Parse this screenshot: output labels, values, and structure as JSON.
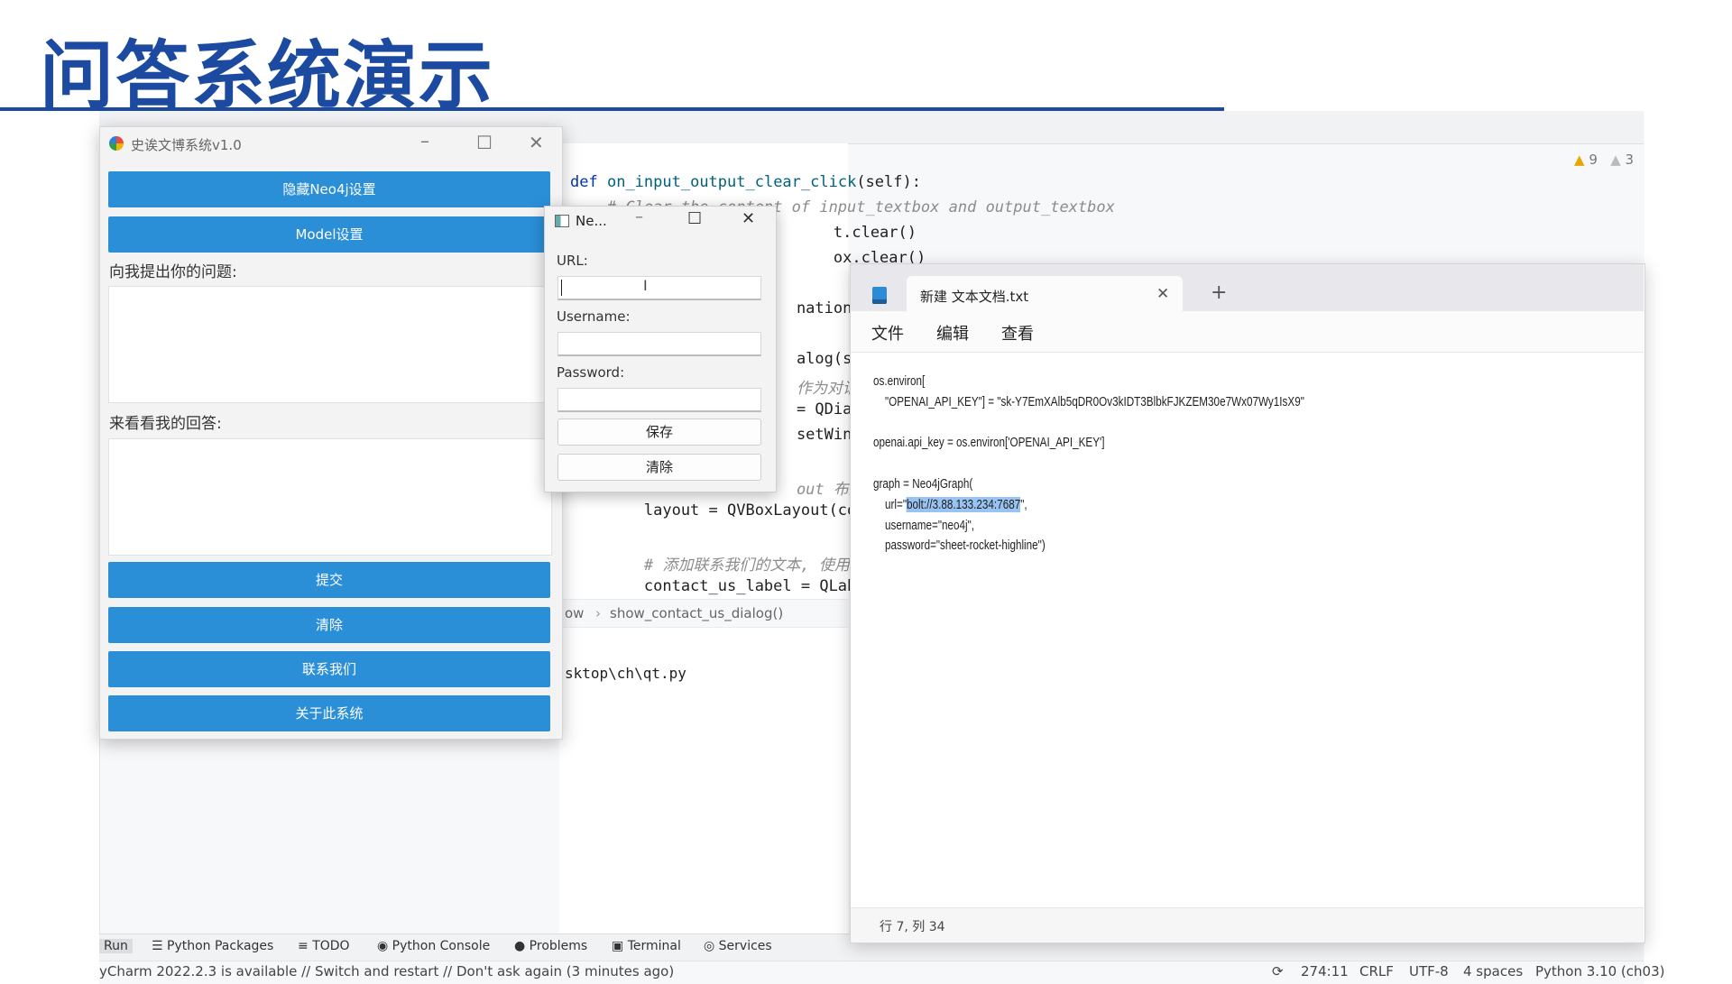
{
  "slide": {
    "title": "问答系统演示"
  },
  "editor": {
    "lines": [
      {
        "t": "def on_input_output_clear_click(self):",
        "k": "def"
      },
      {
        "t": "    # Clear the content of input_textbox and output_textbox",
        "k": "cm"
      },
      {
        "t": "        t.clear()",
        "k": "plain"
      },
      {
        "t": "        ox.clear()",
        "k": "plain"
      },
      {
        "t": "    nation(se",
        "k": "plain"
      },
      {
        "t": "    alog(sel",
        "k": "plain"
      },
      {
        "t": "    作为对话框",
        "k": "cm"
      },
      {
        "t": "    = QDialo",
        "k": "plain"
      },
      {
        "t": "    setWindo",
        "k": "plain"
      },
      {
        "t": "    out 布局,",
        "k": "cm"
      },
      {
        "t": "        layout = QVBoxLayout(conta",
        "k": "plain"
      },
      {
        "t": "        # 添加联系我们的文本, 使用 HTML",
        "k": "cm"
      },
      {
        "t": "        contact_us_label = QLabel(",
        "k": "plain"
      }
    ],
    "breadcrumb": {
      "left": "ow",
      "right": "show_contact_us_dialog()"
    },
    "run_path": "sktop\\ch\\qt.py",
    "warnings": {
      "warn_count": "9",
      "weak_count": "3"
    }
  },
  "tool_strip": {
    "tabs": [
      "Run",
      "Python Packages",
      "TODO",
      "Python Console",
      "Problems",
      "Terminal",
      "Services"
    ]
  },
  "status_bar": {
    "message": "yCharm 2022.2.3 is available // Switch and restart // Don't ask again (3 minutes ago)",
    "position": "274:11",
    "line_sep": "CRLF",
    "encoding": "UTF-8",
    "indent": "4 spaces",
    "interpreter": "Python 3.10 (ch03)"
  },
  "app": {
    "title": "史诶文博系统v1.0",
    "buttons": {
      "hide_neo4j": "隐藏Neo4j设置",
      "model_settings": "Model设置",
      "submit": "提交",
      "clear": "清除",
      "contact": "联系我们",
      "about": "关于此系统"
    },
    "question_label": "向我提出你的问题:",
    "answer_label": "来看看我的回答:"
  },
  "neo_dialog": {
    "title": "Ne...",
    "url_label": "URL:",
    "username_label": "Username:",
    "password_label": "Password:",
    "save": "保存",
    "clear": "清除"
  },
  "notepad": {
    "tab_title": "新建 文本文档.txt",
    "menu": [
      "文件",
      "编辑",
      "查看"
    ],
    "lines": [
      "os.environ[",
      "    \"OPENAI_API_KEY\"] = \"sk-Y7EmXAlb5qDR0Ov3kIDT3BlbkFJKZEM30e7Wx07Wy1IsX9\"",
      "",
      "openai.api_key = os.environ['OPENAI_API_KEY']",
      "",
      "graph = Neo4jGraph(",
      "    url=\"",
      "    username=\"neo4j\",",
      "    password=\"sheet-rocket-highline\")"
    ],
    "url_value": "bolt://3.88.133.234:7687",
    "url_tail": "\",",
    "status": "行 7, 列 34"
  }
}
